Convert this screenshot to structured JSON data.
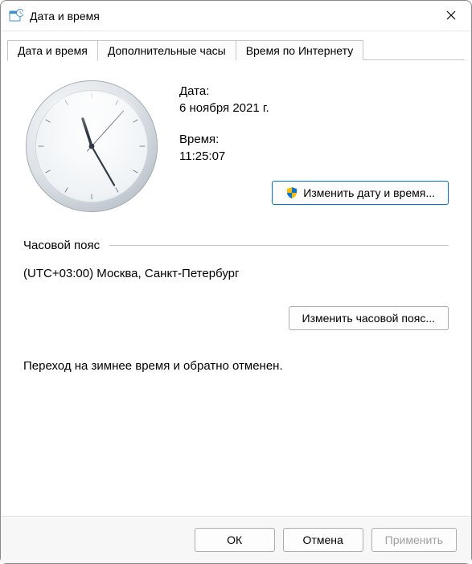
{
  "window": {
    "title": "Дата и время"
  },
  "tabs": [
    {
      "label": "Дата и время"
    },
    {
      "label": "Дополнительные часы"
    },
    {
      "label": "Время по Интернету"
    }
  ],
  "date": {
    "label": "Дата:",
    "value": "6 ноября 2021 г."
  },
  "time": {
    "label": "Время:",
    "value": "11:25:07"
  },
  "clock": {
    "hour_angle": 342,
    "minute_angle": 150,
    "second_angle": 42
  },
  "change_datetime_btn": "Изменить дату и время...",
  "timezone": {
    "header": "Часовой пояс",
    "value": "(UTC+03:00) Москва, Санкт-Петербург",
    "change_btn": "Изменить часовой пояс..."
  },
  "dst_note": "Переход на зимнее время и обратно отменен.",
  "footer": {
    "ok": "ОК",
    "cancel": "Отмена",
    "apply": "Применить"
  }
}
